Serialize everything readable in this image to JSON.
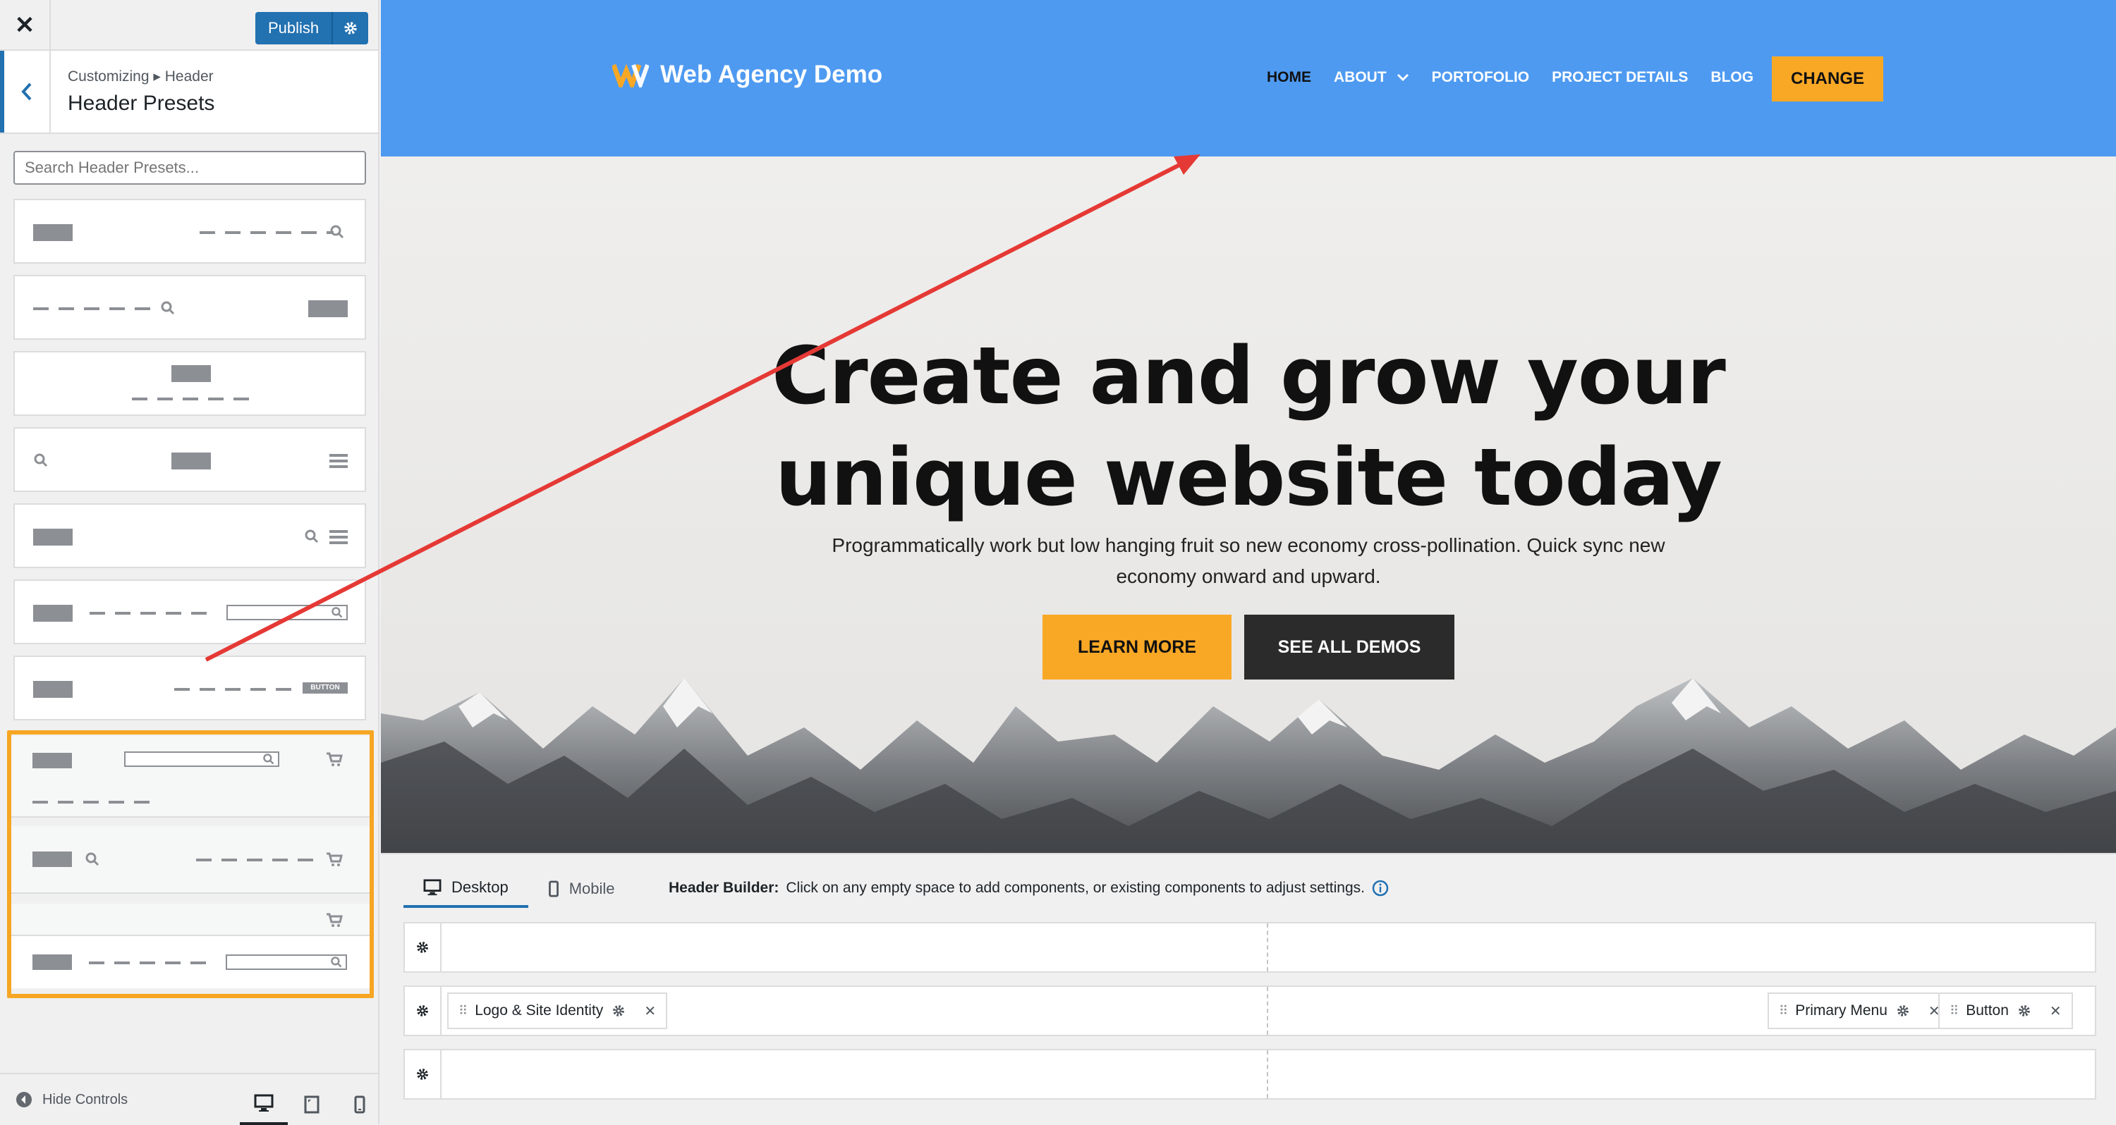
{
  "sidebar": {
    "publish_label": "Publish",
    "breadcrumb": "Customizing ▸ Header",
    "title": "Header Presets",
    "search_placeholder": "Search Header Presets...",
    "footer_label": "Hide Controls"
  },
  "preset_button_text": "BUTTON",
  "site": {
    "logo_text": "Web Agency Demo",
    "nav": [
      "HOME",
      "ABOUT",
      "PORTOFOLIO",
      "PROJECT DETAILS",
      "BLOG"
    ],
    "cta": "CHANGE"
  },
  "hero": {
    "title_line1": "Create and grow your",
    "title_line2": "unique website today",
    "subtitle_line1": "Programmatically work but low hanging fruit so new economy cross-pollination. Quick sync new",
    "subtitle_line2": "economy onward and upward.",
    "primary_button": "LEARN MORE",
    "secondary_button": "SEE ALL DEMOS"
  },
  "builder": {
    "tabs": [
      "Desktop",
      "Mobile"
    ],
    "help_bold": "Header Builder:",
    "help_text": "Click on any empty space to add components, or existing components to adjust settings.",
    "chips": {
      "logo": "Logo & Site Identity",
      "menu": "Primary Menu",
      "button": "Button"
    }
  },
  "colors": {
    "accent": "#2271b1",
    "site_header": "#4e9af1",
    "cta": "#f9a826",
    "highlight": "#f6a623",
    "arrow": "#e53935"
  }
}
